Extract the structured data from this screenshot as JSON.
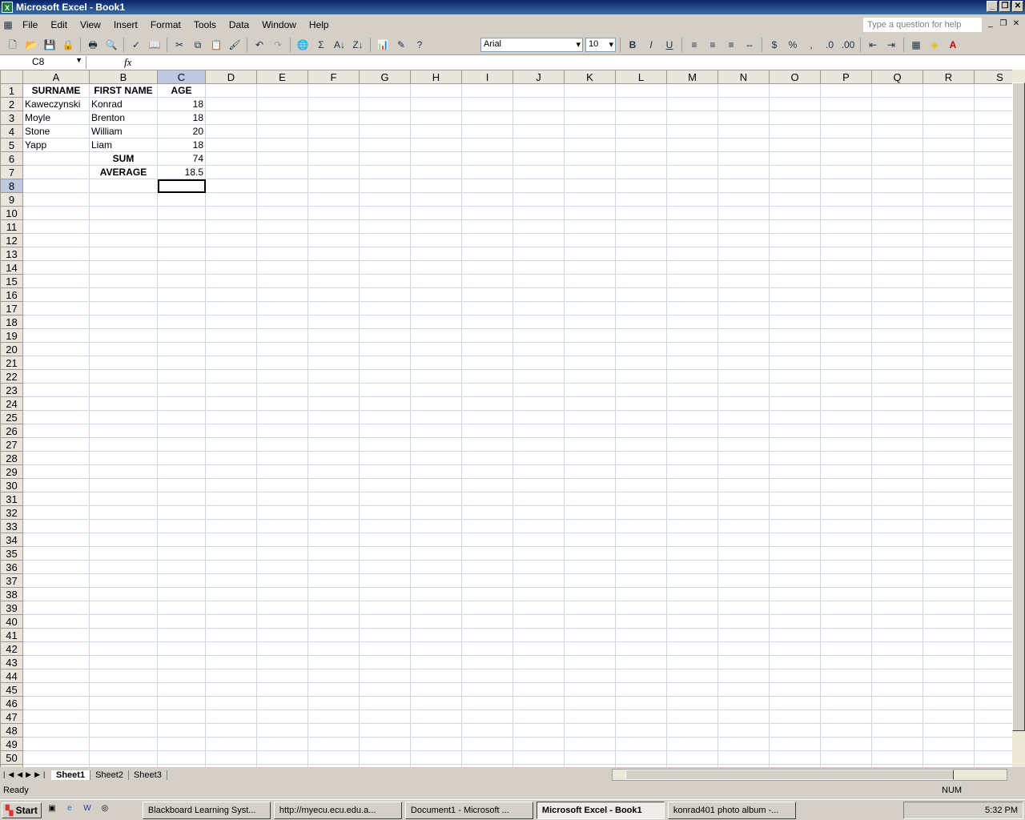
{
  "window": {
    "title": "Microsoft Excel - Book1",
    "app_icon": "excel-icon"
  },
  "menu": [
    "File",
    "Edit",
    "View",
    "Insert",
    "Format",
    "Tools",
    "Data",
    "Window",
    "Help"
  ],
  "help_placeholder": "Type a question for help",
  "toolbar": {
    "font": "Arial",
    "size": "10",
    "bold": "B",
    "italic": "I",
    "underline": "U",
    "currency": "$",
    "percent": "%",
    "comma": ",",
    "sum": "Σ"
  },
  "formula_bar": {
    "name_box": "C8",
    "fx": "fx",
    "value": ""
  },
  "columns": [
    "A",
    "B",
    "C",
    "D",
    "E",
    "F",
    "G",
    "H",
    "I",
    "J",
    "K",
    "L",
    "M",
    "N",
    "O",
    "P",
    "Q",
    "R",
    "S"
  ],
  "row_count": 50,
  "selected": {
    "column": "C",
    "row": 8
  },
  "cells": [
    {
      "A": "SURNAME",
      "B": "FIRST NAME",
      "C": "AGE"
    },
    {
      "A": "Kaweczynski",
      "B": "Konrad",
      "C": "18"
    },
    {
      "A": "Moyle",
      "B": "Brenton",
      "C": "18"
    },
    {
      "A": "Stone",
      "B": "William",
      "C": "20"
    },
    {
      "A": "Yapp",
      "B": "Liam",
      "C": "18"
    },
    {
      "A": "",
      "B": "SUM",
      "C": "74"
    },
    {
      "A": "",
      "B": "AVERAGE",
      "C": "18.5"
    }
  ],
  "sheets": [
    "Sheet1",
    "Sheet2",
    "Sheet3"
  ],
  "status": {
    "text": "Ready",
    "num": "NUM"
  },
  "taskbar": {
    "start": "Start",
    "tasks": [
      "Blackboard Learning Syst...",
      "http://myecu.ecu.edu.a...",
      "Document1 - Microsoft ...",
      "Microsoft Excel - Book1",
      "konrad401 photo album -..."
    ],
    "clock": "5:32 PM"
  }
}
